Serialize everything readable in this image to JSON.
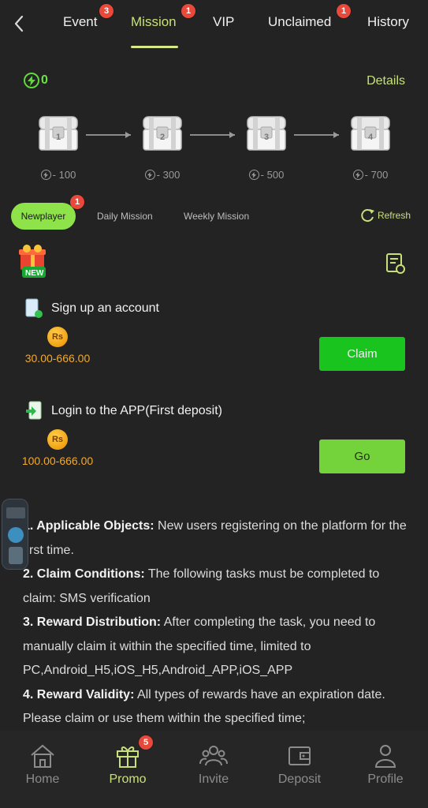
{
  "colors": {
    "background": "#232323",
    "accent": "#c7e07a",
    "active_pill": "#8ee24a",
    "claim_button": "#19c41f",
    "go_button": "#74d33b",
    "reward_text": "#f4a92a",
    "badge": "#e8493b"
  },
  "header": {
    "back_icon": "chevron-left-icon",
    "tabs": [
      {
        "label": "Event",
        "badge": "3",
        "active": false
      },
      {
        "label": "Mission",
        "badge": "1",
        "active": true
      },
      {
        "label": "VIP",
        "badge": "",
        "active": false
      },
      {
        "label": "Unclaimed",
        "badge": "1",
        "active": false
      },
      {
        "label": "History",
        "badge": "",
        "active": false
      }
    ]
  },
  "progress": {
    "points": "0",
    "details_label": "Details",
    "chests": [
      {
        "number": "1",
        "cost": "- 100"
      },
      {
        "number": "2",
        "cost": "- 300"
      },
      {
        "number": "3",
        "cost": "- 500"
      },
      {
        "number": "4",
        "cost": "- 700"
      }
    ]
  },
  "mission_tabs": {
    "newplayer": {
      "label": "Newplayer",
      "badge": "1"
    },
    "daily": "Daily Mission",
    "weekly": "Weekly Mission",
    "refresh": "Refresh"
  },
  "gift_label": "NEW",
  "missions": [
    {
      "title": "Sign up an account",
      "currency": "Rs",
      "reward": "30.00-666.00",
      "button": "Claim"
    },
    {
      "title": "Login to the APP(First deposit)",
      "currency": "Rs",
      "reward": "100.00-666.00",
      "button": "Go"
    }
  ],
  "rules": [
    {
      "num": "1. ",
      "heading": "Applicable Objects:",
      "text": " New users registering on the platform for the first time."
    },
    {
      "num": "2. ",
      "heading": "Claim Conditions:",
      "text": " The following tasks must be completed to claim: SMS verification"
    },
    {
      "num": "3. ",
      "heading": "Reward Distribution:",
      "text": " After completing the task, you need to manually claim it within the specified time, limited to PC,Android_H5,iOS_H5,Android_APP,iOS_APP"
    },
    {
      "num": "4. ",
      "heading": "Reward Validity:",
      "text": " All types of rewards have an expiration date. Please claim or use them within the specified time;"
    }
  ],
  "bottom_nav": [
    {
      "label": "Home",
      "icon": "home-icon",
      "badge": ""
    },
    {
      "label": "Promo",
      "icon": "gift-icon",
      "badge": "5"
    },
    {
      "label": "Invite",
      "icon": "people-icon",
      "badge": ""
    },
    {
      "label": "Deposit",
      "icon": "wallet-icon",
      "badge": ""
    },
    {
      "label": "Profile",
      "icon": "person-icon",
      "badge": ""
    }
  ]
}
